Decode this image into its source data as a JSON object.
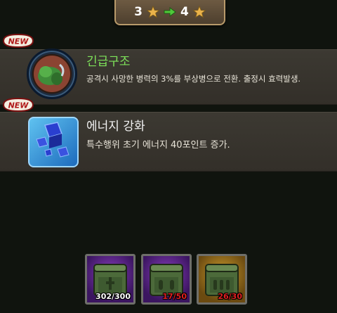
{
  "upgrade": {
    "from": "3",
    "to": "4"
  },
  "skills": [
    {
      "badge": "NEW",
      "name": "긴급구조",
      "description": "공격시 사망한 병력의 3%를 부상병으로 전환. 출정시 효력발생."
    },
    {
      "badge": "NEW",
      "name": "에너지 강화",
      "description": "특수행위 초기 에너지 40포인트 증가."
    }
  ],
  "materials": [
    {
      "count": "302/300",
      "status": "sufficient",
      "frame": "purple"
    },
    {
      "count": "17/50",
      "status": "insufficient",
      "frame": "purple"
    },
    {
      "count": "26/30",
      "status": "insufficient",
      "frame": "gold"
    }
  ],
  "colors": {
    "skill_title_green": "#7ee35a",
    "insufficient_red": "#e02020",
    "sufficient_white": "#ffffff",
    "star_gold": "#e9b24a"
  }
}
